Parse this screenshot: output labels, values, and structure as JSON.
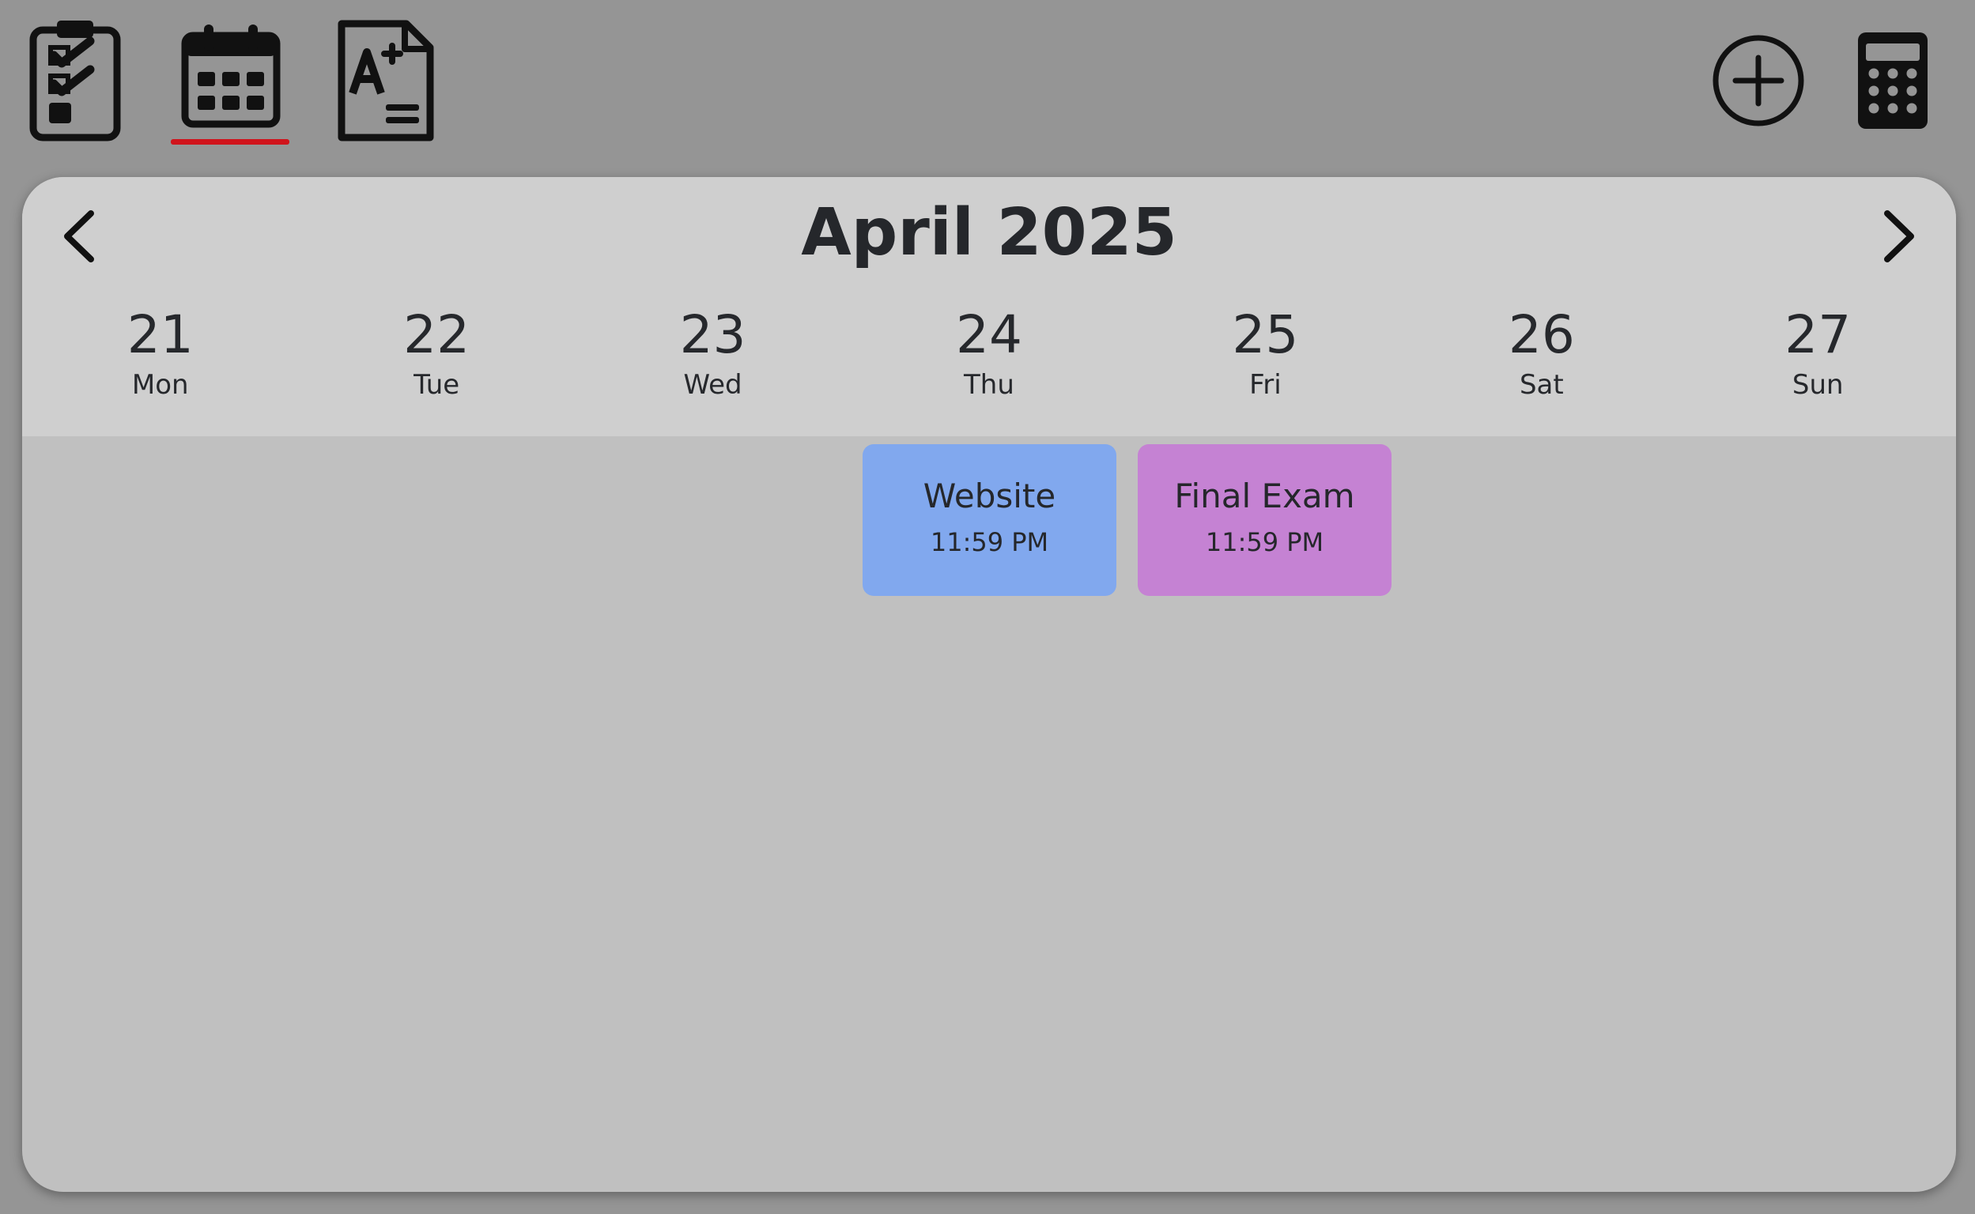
{
  "toolbar": {
    "left_icons": [
      {
        "icon": "clipboard-checklist-icon",
        "active": false
      },
      {
        "icon": "calendar-icon",
        "active": true
      },
      {
        "icon": "grade-document-icon",
        "active": false
      }
    ],
    "right_icons": [
      {
        "icon": "add-circle-icon"
      },
      {
        "icon": "calculator-icon"
      }
    ],
    "active_color": "#d0141c",
    "icon_color": "#111111"
  },
  "calendar": {
    "month_title": "April 2025",
    "prev_icon": "chevron-left-icon",
    "next_icon": "chevron-right-icon",
    "days": [
      {
        "num": "21",
        "name": "Mon"
      },
      {
        "num": "22",
        "name": "Tue"
      },
      {
        "num": "23",
        "name": "Wed"
      },
      {
        "num": "24",
        "name": "Thu"
      },
      {
        "num": "25",
        "name": "Fri"
      },
      {
        "num": "26",
        "name": "Sat"
      },
      {
        "num": "27",
        "name": "Sun"
      }
    ],
    "events": [
      {
        "title": "Website",
        "time": "11:59 PM",
        "day_index": 3,
        "color": "#81a8ee"
      },
      {
        "title": "Final Exam",
        "time": "11:59 PM",
        "day_index": 4,
        "color": "#c582d3"
      }
    ],
    "header_bg": "#cfcfcf",
    "body_bg": "#c0c0c0"
  }
}
